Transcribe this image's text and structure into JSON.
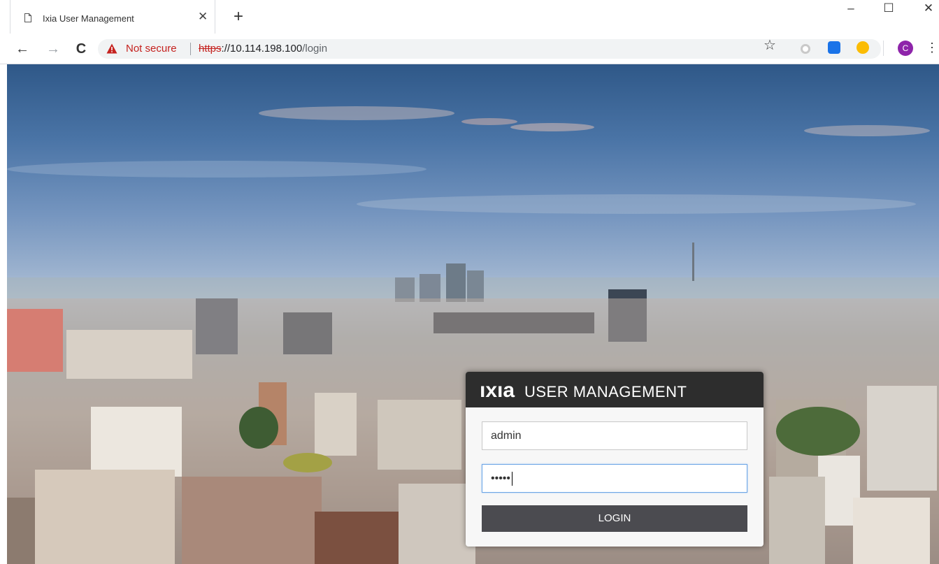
{
  "browser": {
    "tab": {
      "title": "Ixia User Management",
      "close_glyph": "✕",
      "icon": "page-icon"
    },
    "new_tab_glyph": "+",
    "window_controls": {
      "minimize": "–",
      "maximize": "☐",
      "close": "✕"
    },
    "nav": {
      "back": "←",
      "forward": "→",
      "reload": "C"
    },
    "omnibox": {
      "security_label": "Not secure",
      "url_scheme": "https",
      "url_host": "://10.114.198.100",
      "url_path": "/login"
    },
    "bookmark_star": "☆",
    "profile_initial": "C",
    "menu_glyph": "⋮",
    "colors": {
      "warning": "#c5221f",
      "profile": "#8e24aa"
    }
  },
  "login": {
    "logo_text": "ıxıa",
    "title": "USER MANAGEMENT",
    "username_value": "admin",
    "password_value": "•••••",
    "button_label": "LOGIN",
    "colors": {
      "header": "#2d2d2d",
      "logo_accent": "#3fc0c8",
      "button": "#4b4b50"
    }
  }
}
